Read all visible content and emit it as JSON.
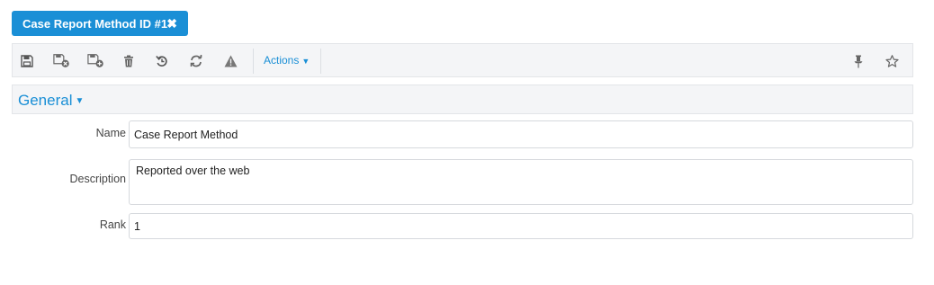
{
  "tab": {
    "title": "Case Report Method ID #1",
    "close_glyph": "✖"
  },
  "toolbar": {
    "icons": [
      "save-icon",
      "save-close-icon",
      "save-new-icon",
      "delete-icon",
      "undo-icon",
      "refresh-icon",
      "warning-icon"
    ],
    "actions_label": "Actions",
    "actions_caret": "▼",
    "right_icons": [
      "pin-icon",
      "star-icon"
    ]
  },
  "section": {
    "title": "General",
    "caret": "▼"
  },
  "form": {
    "name_label": "Name",
    "name_value": "Case Report Method",
    "description_label": "Description",
    "description_value": "Reported over the web",
    "rank_label": "Rank",
    "rank_value": "1"
  },
  "colors": {
    "accent": "#1a8fd6",
    "toolbar_bg": "#f4f5f7",
    "icon": "#555555"
  }
}
